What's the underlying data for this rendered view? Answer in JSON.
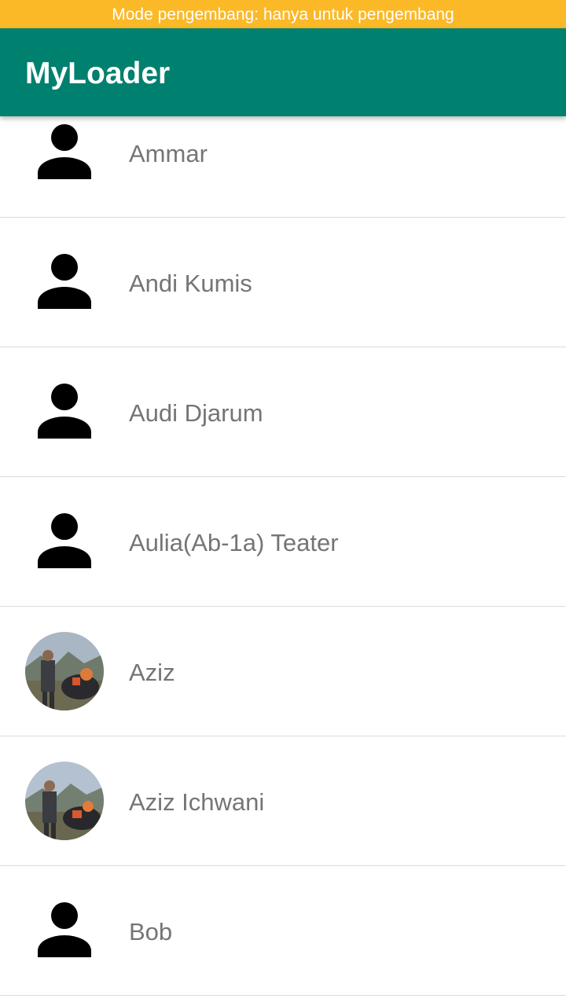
{
  "status_banner": "Mode pengembang: hanya untuk pengembang",
  "app_bar": {
    "title": "MyLoader"
  },
  "colors": {
    "banner": "#fbb928",
    "app_bar": "#00806f",
    "name_text": "#757575",
    "divider": "#dcdcdc",
    "placeholder_icon": "#000000"
  },
  "contacts": [
    {
      "name": "Ammar",
      "avatar": "person-placeholder-icon"
    },
    {
      "name": "Andi Kumis",
      "avatar": "person-placeholder-icon"
    },
    {
      "name": "Audi Djarum",
      "avatar": "person-placeholder-icon"
    },
    {
      "name": "Aulia(Ab-1a) Teater",
      "avatar": "person-placeholder-icon"
    },
    {
      "name": "Aziz",
      "avatar": "contact-photo"
    },
    {
      "name": "Aziz Ichwani",
      "avatar": "contact-photo"
    },
    {
      "name": "Bob",
      "avatar": "person-placeholder-icon"
    }
  ]
}
